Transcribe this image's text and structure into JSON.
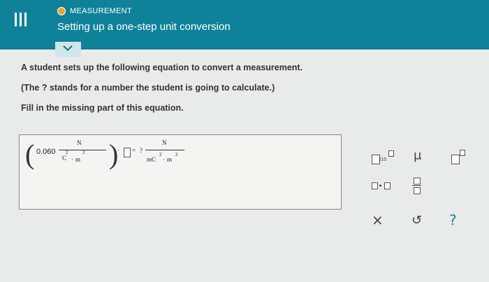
{
  "header": {
    "topic": "MEASUREMENT",
    "title": "Setting up a one-step unit conversion"
  },
  "content": {
    "line1": "A student sets up the following equation to convert a measurement.",
    "line2": "(The ? stands for a number the student is going to calculate.)",
    "line3": "Fill in the missing part of this equation."
  },
  "equation": {
    "coefficient": "0.060",
    "lhs_numerator": "N",
    "lhs_denom_c": "C",
    "lhs_denom_dot": "·",
    "lhs_denom_m": "m",
    "exp_c": "2",
    "exp_m": "2",
    "middle_dot": "·",
    "equals": "=",
    "unknown": "?",
    "rhs_numerator": "N",
    "rhs_denom_mc": "mC",
    "rhs_denom_dot": "·",
    "rhs_denom_m": "m",
    "rhs_exp_c": "2",
    "rhs_exp_m": "2"
  },
  "palette": {
    "sci_label": "x10",
    "mu": "μ",
    "clear": "×",
    "undo": "↺",
    "help": "?"
  },
  "colors": {
    "header": "#0f8299",
    "topic_dot": "#f2a125",
    "help_color": "#1e7fa0"
  }
}
